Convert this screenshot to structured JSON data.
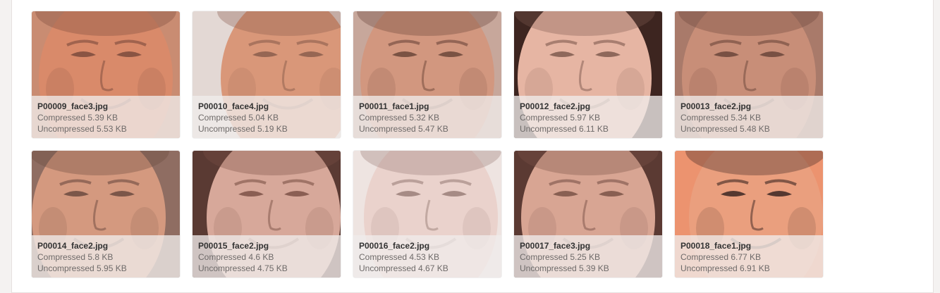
{
  "gallery": {
    "items": [
      {
        "filename": "P00009_face3.jpg",
        "compressed": "Compressed 5.39 KB",
        "uncompressed": "Uncompressed 5.53 KB",
        "skin": "#d98a6a",
        "bg": "#c98c72",
        "dark": "#7a4a3c"
      },
      {
        "filename": "P00010_face4.jpg",
        "compressed": "Compressed 5.04 KB",
        "uncompressed": "Uncompressed 5.19 KB",
        "skin": "#d99779",
        "bg": "#e3d8d4",
        "dark": "#8a5d4c"
      },
      {
        "filename": "P00011_face1.jpg",
        "compressed": "Compressed 5.32 KB",
        "uncompressed": "Uncompressed 5.47 KB",
        "skin": "#d2977f",
        "bg": "#c7a79b",
        "dark": "#6b4538"
      },
      {
        "filename": "P00012_face2.jpg",
        "compressed": "Compressed 5.97 KB",
        "uncompressed": "Uncompressed 6.11 KB",
        "skin": "#e6b5a3",
        "bg": "#3d2520",
        "dark": "#7e5a4f"
      },
      {
        "filename": "P00013_face2.jpg",
        "compressed": "Compressed 5.34 KB",
        "uncompressed": "Uncompressed 5.48 KB",
        "skin": "#c88e78",
        "bg": "#a97a6a",
        "dark": "#6a4539"
      },
      {
        "filename": "P00014_face2.jpg",
        "compressed": "Compressed 5.8 KB",
        "uncompressed": "Uncompressed 5.95 KB",
        "skin": "#d4997f",
        "bg": "#8f6d62",
        "dark": "#6b4a3f"
      },
      {
        "filename": "P00015_face2.jpg",
        "compressed": "Compressed 4.6 KB",
        "uncompressed": "Uncompressed 4.75 KB",
        "skin": "#d7a89a",
        "bg": "#5a3a33",
        "dark": "#7c5146"
      },
      {
        "filename": "P00016_face2.jpg",
        "compressed": "Compressed 4.53 KB",
        "uncompressed": "Uncompressed 4.67 KB",
        "skin": "#ead2cc",
        "bg": "#eee4e1",
        "dark": "#9a7f78"
      },
      {
        "filename": "P00017_face3.jpg",
        "compressed": "Compressed 5.25 KB",
        "uncompressed": "Uncompressed 5.39 KB",
        "skin": "#d8a593",
        "bg": "#5b3a33",
        "dark": "#7a5247"
      },
      {
        "filename": "P00018_face1.jpg",
        "compressed": "Compressed 6.77 KB",
        "uncompressed": "Uncompressed 6.91 KB",
        "skin": "#ea9f7e",
        "bg": "#ec936f",
        "dark": "#3b2622"
      }
    ]
  }
}
